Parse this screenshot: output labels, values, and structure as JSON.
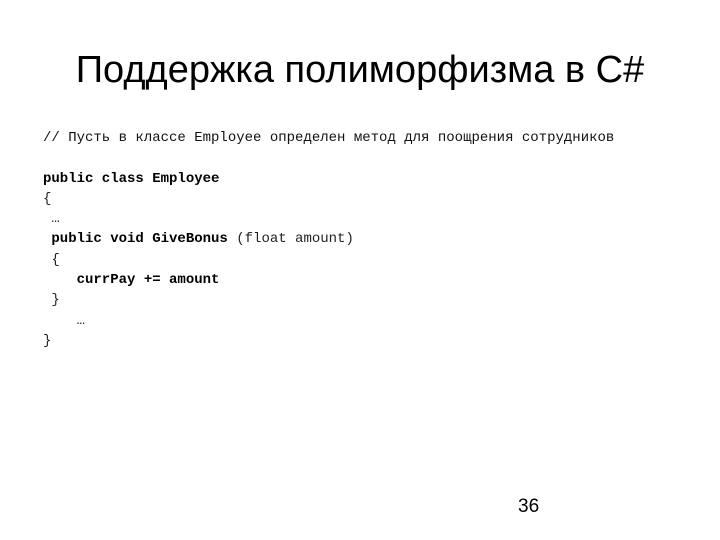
{
  "slide": {
    "title": "Поддержка полиморфизма в C#",
    "page_number": "36",
    "code": {
      "comment": "// Пусть в классе Employee определен метод для поощрения сотрудников",
      "blank": "",
      "class_decl": "public class Employee",
      "open_brace_1": "{",
      "ellipsis_1": " …",
      "method_decl_bold": " public void GiveBonus",
      "method_params": " (float amount)",
      "open_brace_2": " {",
      "body_stmt": "    currPay += amount",
      "close_brace_2": " }",
      "ellipsis_2": "    …",
      "close_brace_1": "}"
    }
  }
}
